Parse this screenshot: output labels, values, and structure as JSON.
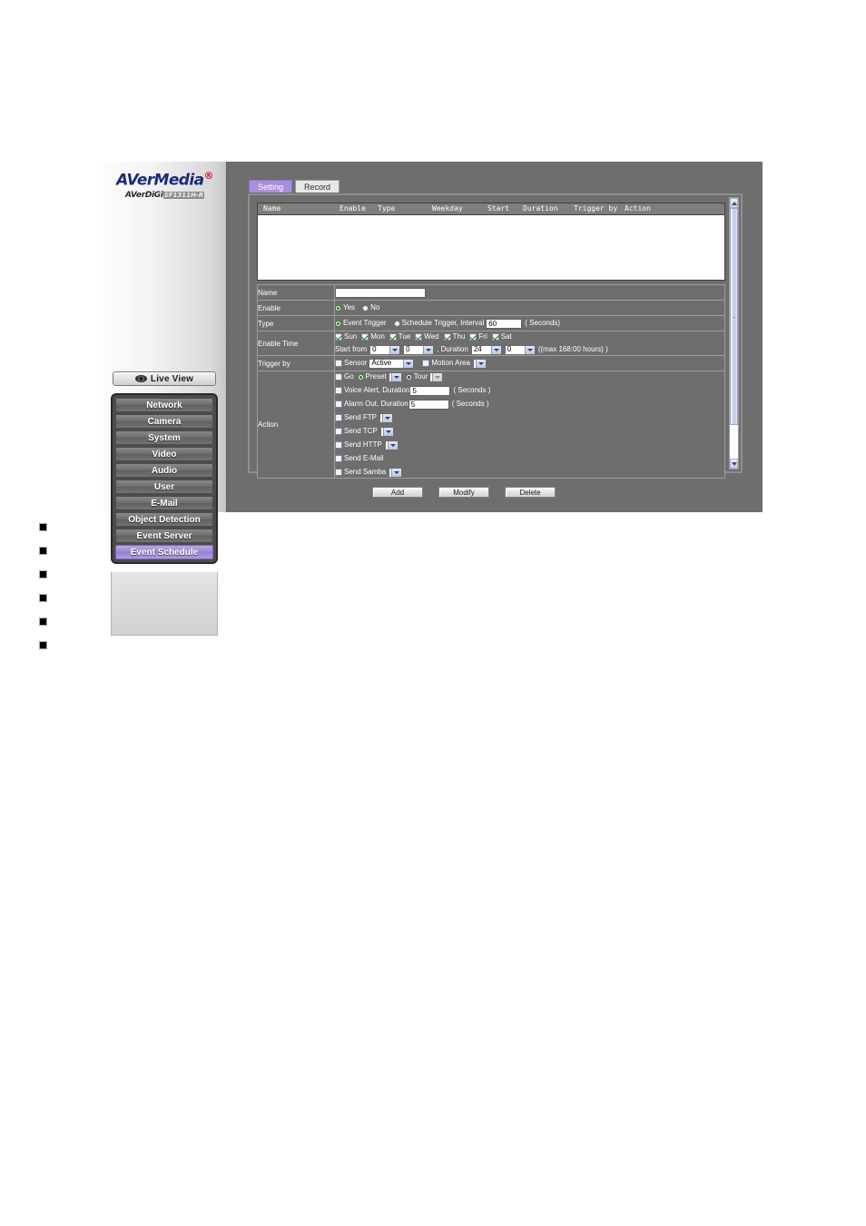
{
  "brand": {
    "name_part1": "AVer",
    "name_part2": "Media",
    "trademark": "®",
    "sub_prefix": "AVerDiGi",
    "model": "SF1311H-R"
  },
  "sidebar": {
    "live_view_label": "Live View",
    "items": [
      {
        "label": "Network",
        "active": false
      },
      {
        "label": "Camera",
        "active": false
      },
      {
        "label": "System",
        "active": false
      },
      {
        "label": "Video",
        "active": false
      },
      {
        "label": "Audio",
        "active": false
      },
      {
        "label": "User",
        "active": false
      },
      {
        "label": "E-Mail",
        "active": false
      },
      {
        "label": "Object Detection",
        "active": false
      },
      {
        "label": "Event Server",
        "active": false
      },
      {
        "label": "Event Schedule",
        "active": true
      }
    ]
  },
  "tabs": [
    {
      "label": "Setting",
      "selected": true
    },
    {
      "label": "Record",
      "selected": false
    }
  ],
  "schedule_list": {
    "columns": [
      "Name",
      "Enable",
      "Type",
      "Weekday",
      "Start",
      "Duration",
      "Trigger by",
      "Action"
    ],
    "rows": []
  },
  "form": {
    "name": {
      "label": "Name",
      "value": "",
      "placeholder": ""
    },
    "enable": {
      "label": "Enable",
      "yes_label": "Yes",
      "no_label": "No",
      "selected": "Yes"
    },
    "type": {
      "label": "Type",
      "event_trigger_label": "Event Trigger",
      "schedule_trigger_label": "Schedule Trigger, Interval",
      "selected": "Event Trigger",
      "interval_value": "60",
      "interval_units": "( Seconds)"
    },
    "enable_time": {
      "label": "Enable Time",
      "days": [
        {
          "label": "Sun",
          "checked": true
        },
        {
          "label": "Mon",
          "checked": true
        },
        {
          "label": "Tue",
          "checked": true
        },
        {
          "label": "Wed",
          "checked": true
        },
        {
          "label": "Thu",
          "checked": true
        },
        {
          "label": "Fri",
          "checked": true
        },
        {
          "label": "Sat",
          "checked": true
        }
      ],
      "start_from_label": "Start from",
      "start_hour": "0",
      "start_minute": "0",
      "duration_label": ", Duration",
      "duration_hour": "24",
      "duration_minute": "0",
      "max_note": "((max 168:00 hours) )"
    },
    "trigger_by": {
      "label": "Trigger by",
      "sensor_label": "Sensor",
      "sensor_checked": false,
      "sensor_value": "Active",
      "motion_area_label": "Motion Area",
      "motion_area_checked": false,
      "motion_area_value": ""
    },
    "action": {
      "label": "Action",
      "go": {
        "label": "Go",
        "checked": false,
        "preset_label": "Preset",
        "preset_selected": true,
        "preset_value": "",
        "tour_label": "Tour",
        "tour_selected": false,
        "tour_value": ""
      },
      "items": [
        {
          "label": "Voice Alert, Duration",
          "checked": false,
          "value": "5",
          "units": "( Seconds )",
          "widget": "text"
        },
        {
          "label": "Alarm Out, Duration",
          "checked": false,
          "value": "5",
          "units": "( Seconds )",
          "widget": "text"
        },
        {
          "label": "Send FTP",
          "checked": false,
          "value": "",
          "units": "",
          "widget": "select"
        },
        {
          "label": "Send TCP",
          "checked": false,
          "value": "",
          "units": "",
          "widget": "select"
        },
        {
          "label": "Send HTTP",
          "checked": false,
          "value": "",
          "units": "",
          "widget": "select"
        },
        {
          "label": "Send E-Mail",
          "checked": false,
          "value": "",
          "units": "",
          "widget": "none"
        },
        {
          "label": "Send Samba",
          "checked": false,
          "value": "",
          "units": "",
          "widget": "select"
        }
      ]
    }
  },
  "buttons": [
    {
      "label": "Add"
    },
    {
      "label": "Modify"
    },
    {
      "label": "Delete"
    }
  ],
  "scrollbar": {
    "up_icon": "chevron-up-icon",
    "down_icon": "chevron-down-icon"
  },
  "page_bullets": {
    "count": 6
  },
  "colors": {
    "accent_purple": "#a78fdc",
    "panel_gray": "#6e6e6e",
    "brand_blue": "#1b2b78",
    "brand_red": "#cc1122"
  }
}
